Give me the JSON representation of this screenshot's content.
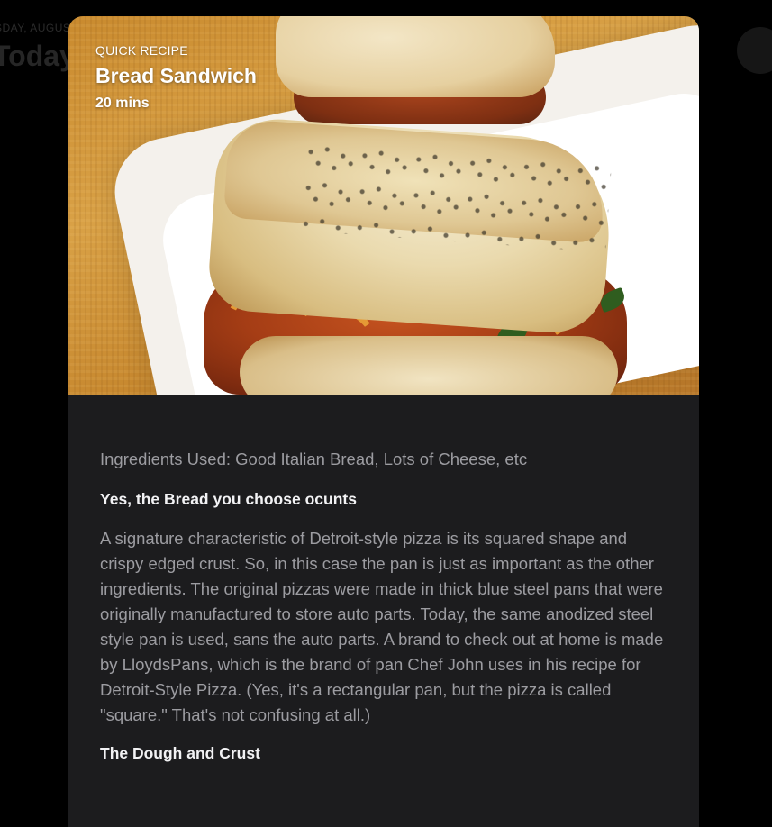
{
  "background": {
    "date_label": "SDAY, AUGUST",
    "heading": "Today"
  },
  "card": {
    "eyebrow": "QUICK RECIPE",
    "title": "Bread Sandwich",
    "duration": "20 mins",
    "ingredients": "Ingredients Used: Good Italian Bread, Lots of Cheese, etc",
    "sections": [
      {
        "heading": "Yes, the Bread you choose ocunts",
        "body": "A signature characteristic of Detroit-style pizza is its squared shape and crispy edged crust. So, in this case the pan is just as important as the other ingredients. The original pizzas were made in thick blue steel pans that were originally manufactured to store auto parts. Today, the same anodized steel style pan is used, sans the auto parts. A brand to check out at home is made by LloydsPans, which is the brand of pan Chef John uses in his recipe for Detroit-Style Pizza. (Yes, it's a rectangular pan, but the pizza is called \"square.\" That's not confusing at all.)"
      },
      {
        "heading": "The Dough and Crust"
      }
    ]
  },
  "colors": {
    "page_bg": "#000000",
    "card_bg": "#1c1c1e",
    "heading_text": "#f2f2f4",
    "body_text": "#9c9ca1"
  }
}
